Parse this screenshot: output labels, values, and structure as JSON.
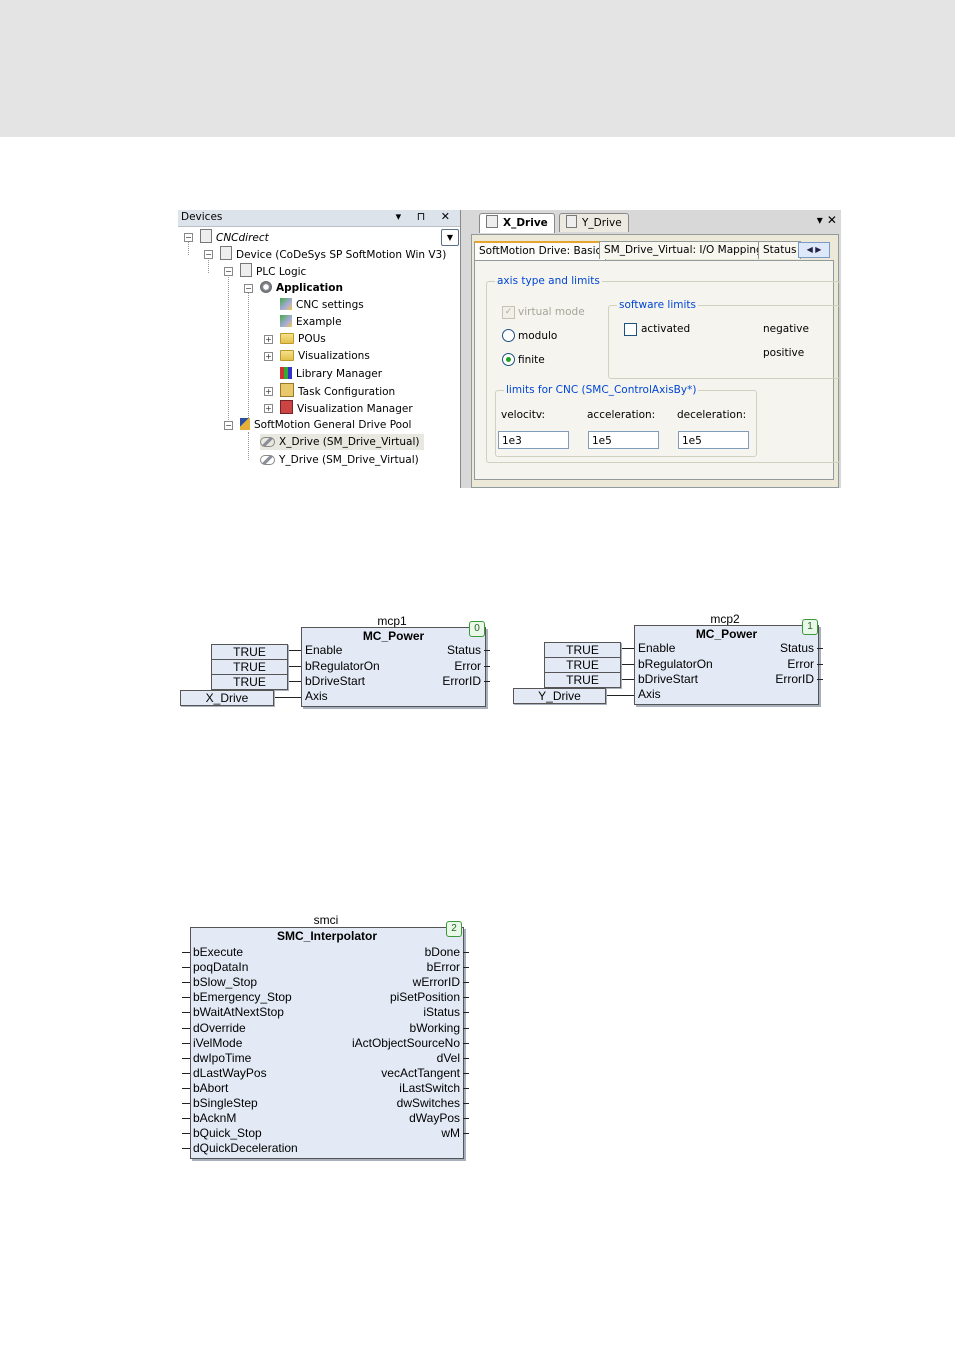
{
  "devices": {
    "title": "Devices",
    "window_buttons": "▾ ⊓ ✕",
    "tree": [
      {
        "label": "CNCdirect",
        "icon": "project-icon"
      },
      {
        "label": "Device (CoDeSys SP SoftMotion Win V3)",
        "icon": "device-icon"
      },
      {
        "label": "PLC Logic",
        "icon": "plc-logic-icon"
      },
      {
        "label": "Application",
        "icon": "application-gear-icon"
      },
      {
        "label": "CNC settings",
        "icon": "cnc-settings-icon"
      },
      {
        "label": "Example",
        "icon": "cnc-example-icon"
      },
      {
        "label": "POUs",
        "icon": "folder-icon"
      },
      {
        "label": "Visualizations",
        "icon": "folder-icon"
      },
      {
        "label": "Library Manager",
        "icon": "library-icon"
      },
      {
        "label": "Task Configuration",
        "icon": "task-icon"
      },
      {
        "label": "Visualization Manager",
        "icon": "visualization-manager-icon"
      },
      {
        "label": "SoftMotion General Drive Pool",
        "icon": "drive-pool-icon"
      },
      {
        "label": "X_Drive (SM_Drive_Virtual)",
        "icon": "axis-icon"
      },
      {
        "label": "Y_Drive (SM_Drive_Virtual)",
        "icon": "axis-icon"
      }
    ]
  },
  "editor": {
    "doc_tabs": [
      "X_Drive",
      "Y_Drive"
    ],
    "tabbar_buttons": "▾ ✕",
    "page_tabs": [
      "SoftMotion Drive: Basic",
      "SM_Drive_Virtual: I/O Mapping",
      "Status"
    ],
    "axis_group": {
      "title": "axis type and limits",
      "virtual_mode": "virtual mode",
      "modulo": "modulo",
      "finite": "finite",
      "selected": "finite"
    },
    "software_limits": {
      "title": "software limits",
      "activated": "activated",
      "negative": "negative",
      "positive": "positive"
    },
    "cnc_limits": {
      "title": "limits for CNC (SMC_ControlAxisBy*)",
      "velocity_label": "velocitv:",
      "acceleration_label": "acceleration:",
      "deceleration_label": "deceleration:",
      "velocity": "1e3",
      "acceleration": "1e5",
      "deceleration": "1e5"
    }
  },
  "mcp1": {
    "instance": "mcp1",
    "type": "MC_Power",
    "index": "0",
    "inputs": [
      "Enable",
      "bRegulatorOn",
      "bDriveStart",
      "Axis"
    ],
    "outputs": [
      "Status",
      "Error",
      "ErrorID"
    ],
    "consts": [
      "TRUE",
      "TRUE",
      "TRUE"
    ],
    "axis": "X_Drive"
  },
  "mcp2": {
    "instance": "mcp2",
    "type": "MC_Power",
    "index": "1",
    "inputs": [
      "Enable",
      "bRegulatorOn",
      "bDriveStart",
      "Axis"
    ],
    "outputs": [
      "Status",
      "Error",
      "ErrorID"
    ],
    "consts": [
      "TRUE",
      "TRUE",
      "TRUE"
    ],
    "axis": "Y_Drive"
  },
  "smci": {
    "instance": "smci",
    "type": "SMC_Interpolator",
    "index": "2",
    "inputs": [
      "bExecute",
      "poqDataIn",
      "bSlow_Stop",
      "bEmergency_Stop",
      "bWaitAtNextStop",
      "dOverride",
      "iVelMode",
      "dwIpoTime",
      "dLastWayPos",
      "bAbort",
      "bSingleStep",
      "bAcknM",
      "bQuick_Stop",
      "dQuickDeceleration"
    ],
    "outputs": [
      "bDone",
      "bError",
      "wErrorID",
      "piSetPosition",
      "iStatus",
      "bWorking",
      "iActObjectSourceNo",
      "dVel",
      "vecActTangent",
      "iLastSwitch",
      "dwSwitches",
      "dWayPos",
      "wM"
    ]
  }
}
